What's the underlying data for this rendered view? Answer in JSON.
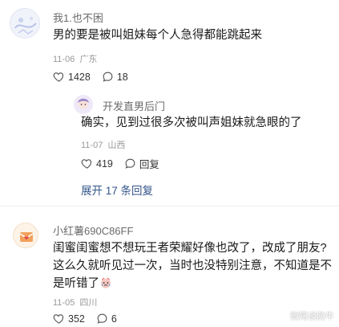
{
  "comments": [
    {
      "username": "我1.也不困",
      "text": "男的要是被叫姐妹每个人急得都能跳起来",
      "date": "11-06",
      "location": "广东",
      "likes": "1428",
      "replies_count": "18",
      "reply": {
        "username": "开发直男后门",
        "text": "确实，见到过很多次被叫声姐妹就急眼的了",
        "date": "11-07",
        "location": "山西",
        "likes": "419",
        "reply_label": "回复"
      },
      "expand_label": "展开 17 条回复"
    },
    {
      "username": "小红薯690C86FF",
      "text_line1": "闺蜜闺蜜想不想玩王者荣耀好像也改了，改成了朋友?",
      "text_line2": "这么久就听见过一次，当时也没特别注意，不知道是不",
      "text_line3": "是听错了",
      "date": "11-05",
      "location": "四川",
      "likes": "352",
      "replies_count": "6"
    }
  ],
  "watermark": "微殇谈防牛",
  "colors": {
    "link": "#34568b",
    "meta": "#9a9a9a",
    "avatar_badge": "#f2a15c"
  }
}
